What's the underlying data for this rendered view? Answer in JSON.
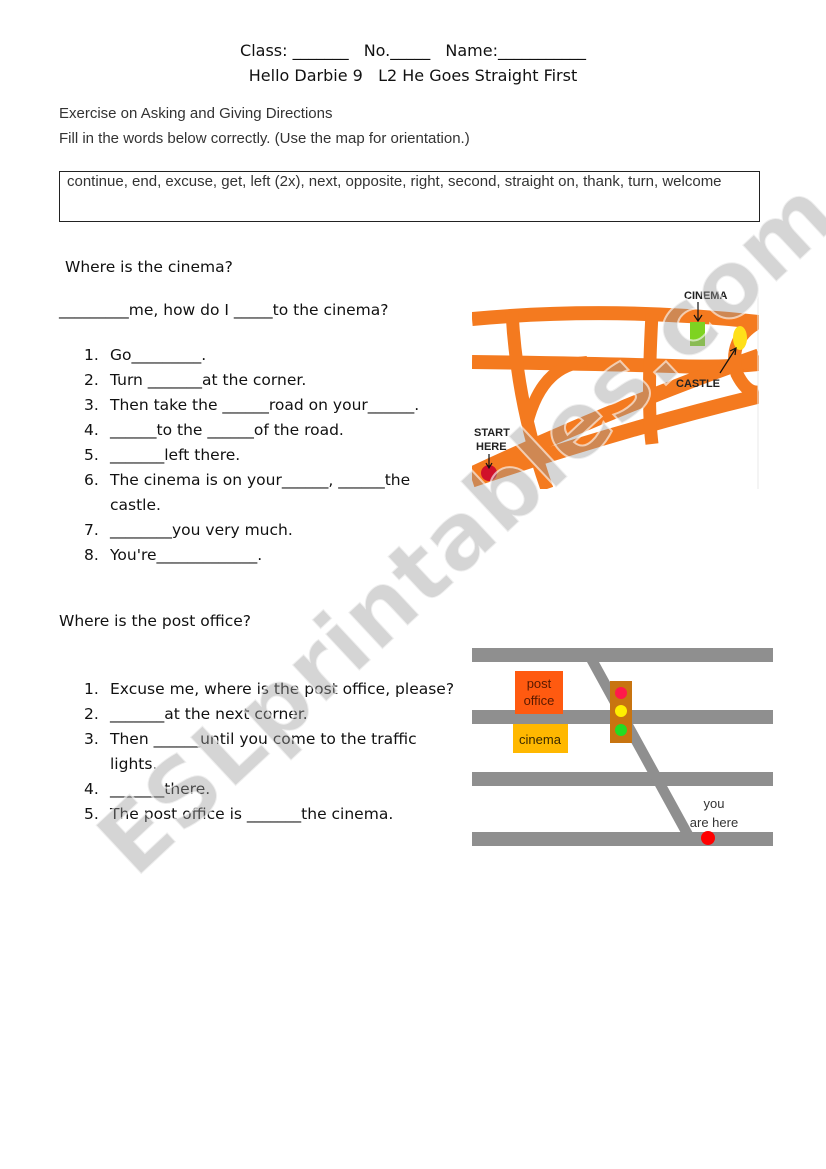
{
  "header": {
    "class_label": "Class: _______",
    "no_label": "No._____",
    "name_label": "Name:___________",
    "subtitle": "Hello Darbie 9   L2 He Goes Straight First"
  },
  "intro": {
    "title": "Exercise on Asking and Giving Directions",
    "instruction": "Fill in the words below correctly. (Use the map for orientation.)"
  },
  "word_bank": "continue, end, excuse, get, left (2x), next, opposite, right, second, straight on, thank, turn, welcome",
  "cinema_section": {
    "heading": "Where is the cinema?",
    "question": "_________me, how do I _____to the cinema?",
    "items": [
      {
        "num": "1.",
        "text": "Go_________."
      },
      {
        "num": "2.",
        "text": "Turn _______at the corner."
      },
      {
        "num": "3.",
        "text": "Then take the ______road on your______."
      },
      {
        "num": "4.",
        "text": "______to the ______of the road."
      },
      {
        "num": "5.",
        "text": "_______left there."
      },
      {
        "num": "6.",
        "text": "The cinema is on your______, ______the castle."
      },
      {
        "num": "7.",
        "text": "________you very much."
      },
      {
        "num": "8.",
        "text": "You're_____________."
      }
    ],
    "map": {
      "labels": {
        "cinema": "CINEMA",
        "castle": "CASTLE",
        "start_line1": "START",
        "start_line2": "HERE"
      },
      "colors": {
        "road": "#f47a1f",
        "cinema": "#7ed321",
        "castle": "#ffe01a",
        "start": "#d0102a"
      }
    }
  },
  "post_office_section": {
    "heading": "Where is the post office?",
    "items": [
      {
        "num": "1.",
        "text": "Excuse me, where is the post office, please?"
      },
      {
        "num": "2.",
        "text": "_______at the next corner."
      },
      {
        "num": "3.",
        "text": "Then ______until you come to the traffic lights."
      },
      {
        "num": "4.",
        "text": "_______there."
      },
      {
        "num": "5.",
        "text": "The post office is _______the cinema."
      }
    ],
    "map": {
      "labels": {
        "post_line1": "post",
        "post_line2": "office",
        "cinema": "cinema",
        "you_line1": "you",
        "you_line2": "are here"
      },
      "colors": {
        "road": "#8f8f8f",
        "post_office": "#ff5a10",
        "cinema": "#ffb800",
        "light_red": "#ff1a4a",
        "light_yellow": "#ffee00",
        "light_green": "#22dd22",
        "light_box": "#c87410",
        "you_dot": "#ff0000"
      }
    }
  },
  "watermark": "ESLprintables.com"
}
